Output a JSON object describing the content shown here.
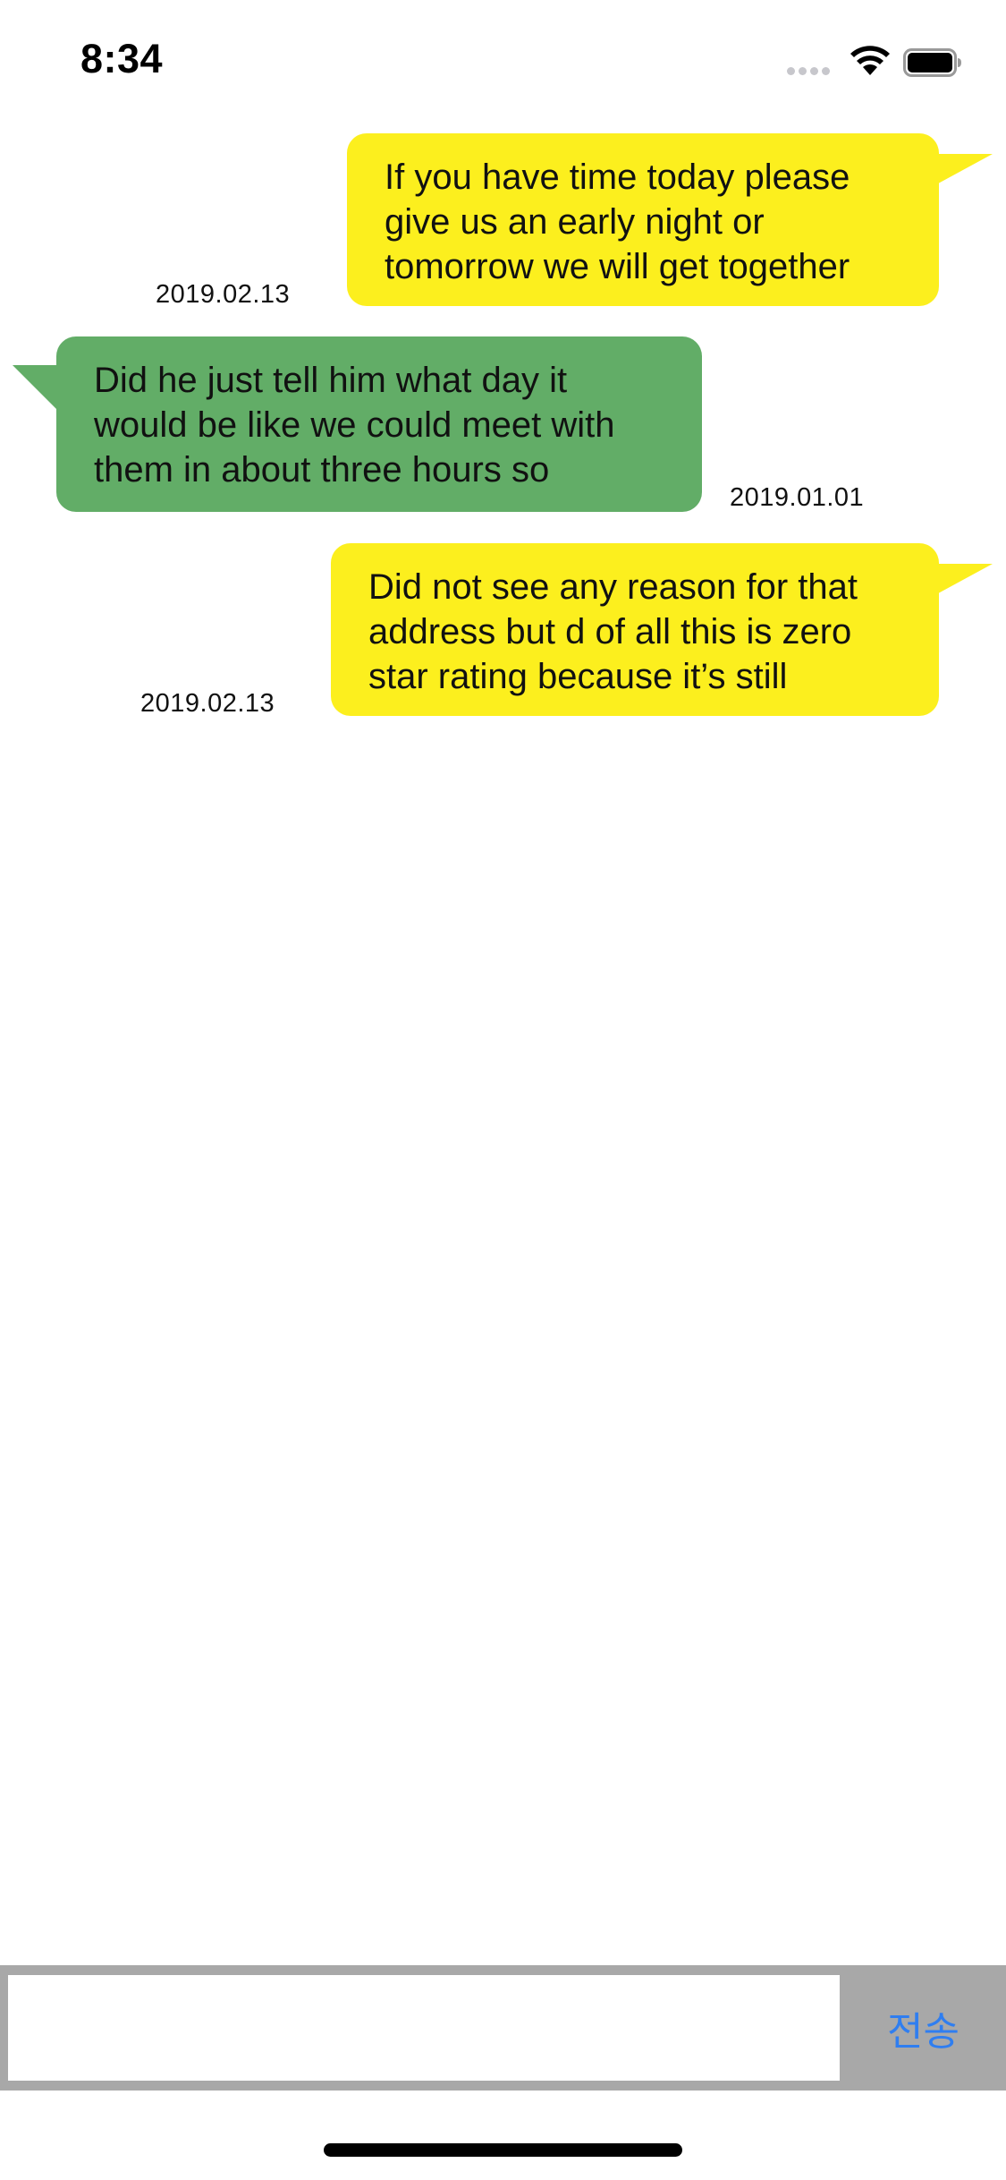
{
  "status_bar": {
    "time": "8:34"
  },
  "messages": [
    {
      "side": "mine",
      "text": "If you have time today please give us an early night or tomorrow we will get together",
      "date": "2019.02.13"
    },
    {
      "side": "theirs",
      "text": "Did he just tell him what day it would be like we could meet with them in about three hours so",
      "date": "2019.01.01"
    },
    {
      "side": "mine",
      "text": "Did not see any reason for that address but d of all this is zero star rating because it’s still",
      "date": "2019.02.13"
    }
  ],
  "composer": {
    "input_value": "",
    "send_label": "전송"
  },
  "colors": {
    "mine_bubble": "#fcef1e",
    "theirs_bubble": "#62ad67",
    "input_bar": "#a8a8a8",
    "send_text": "#2f7ef0"
  }
}
